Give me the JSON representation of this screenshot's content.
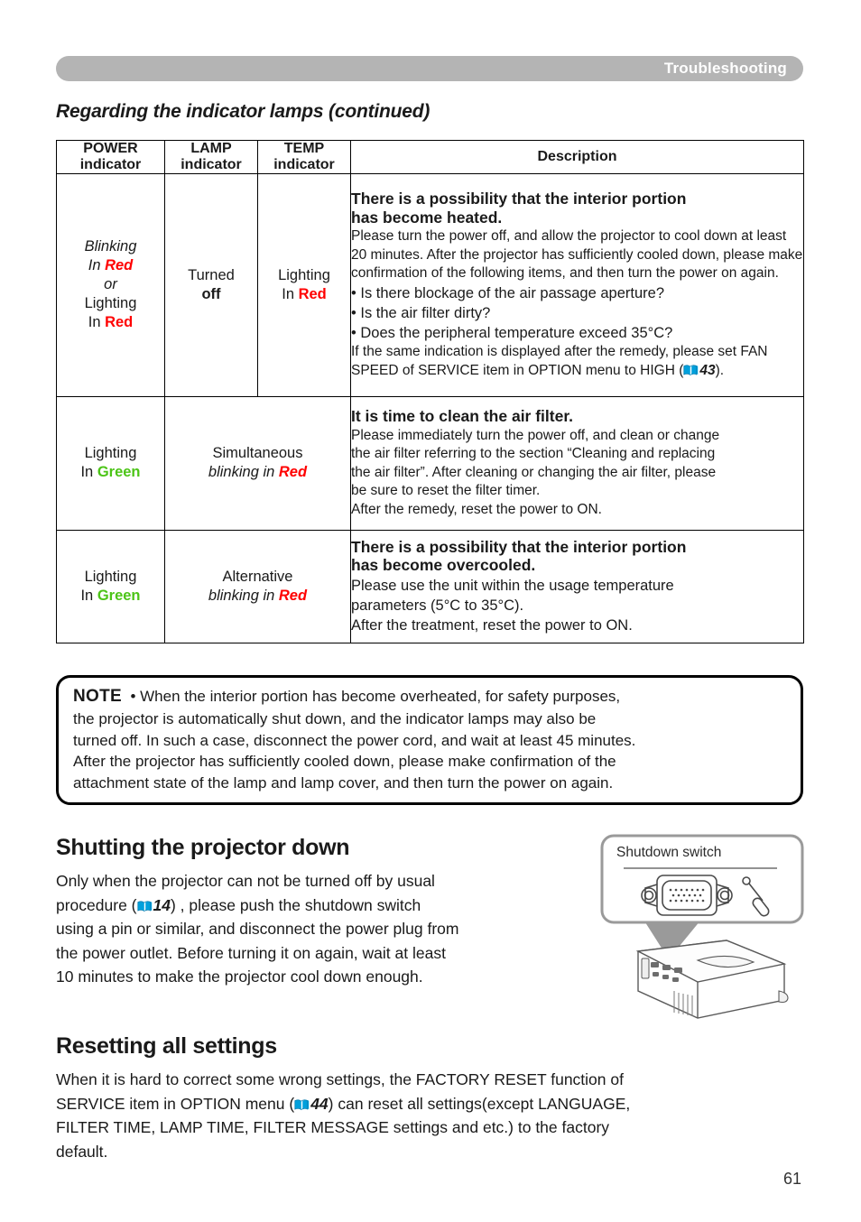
{
  "header": {
    "title": "Troubleshooting"
  },
  "section_heading": "Regarding the indicator lamps (continued)",
  "table": {
    "columns": [
      "POWER indicator",
      "LAMP indicator",
      "TEMP indicator",
      "Description"
    ],
    "column_labels": {
      "power_top": "POWER",
      "power_bottom": "indicator",
      "lamp_top": "LAMP",
      "lamp_bottom": "indicator",
      "temp_top": "TEMP",
      "temp_bottom": "indicator",
      "description": "Description"
    },
    "rows": [
      {
        "power": {
          "l1": "Blinking",
          "l2_prefix": "In ",
          "l2_color": "Red",
          "l3": "or",
          "l4": "Lighting",
          "l5_prefix": "In ",
          "l5_color": "Red"
        },
        "lamp": {
          "l1": "Turned",
          "l2": "off"
        },
        "temp": {
          "l1": "Lighting",
          "l2_prefix": "In ",
          "l2_color": "Red"
        },
        "title_lines": [
          "There is a possibility that the interior portion",
          "has become heated."
        ],
        "body_lines": [
          "Please turn the power off, and allow the projector to cool down at least",
          "20 minutes. After the projector has sufficiently cooled down, please make",
          "confirmation of the following items, and then turn the power on again."
        ],
        "bullets": [
          "• Is there blockage of the air passage aperture?",
          "• Is the air filter dirty?",
          "• Does the peripheral temperature exceed 35°C?"
        ],
        "tail_lines": [
          "If the same indication is displayed after the remedy, please set FAN",
          "SPEED of SERVICE item in OPTION menu to HIGH ("
        ],
        "tail_ref": "43",
        "tail_end": ")."
      },
      {
        "power": {
          "l1": "Lighting",
          "l2_prefix": "In ",
          "l2_color": "Green"
        },
        "lamp": {
          "l1": "Simultaneous",
          "l2_italic": "blinking in ",
          "l2_color": "Red"
        },
        "title_lines": [
          "It is time to clean the air filter."
        ],
        "body_lines": [
          "Please immediately turn the power off, and clean or change",
          "the air filter referring to the section “Cleaning and replacing",
          "the air filter”. After cleaning or changing the air filter, please",
          "be sure to reset the filter timer.",
          "After the remedy, reset the power to ON."
        ]
      },
      {
        "power": {
          "l1": "Lighting",
          "l2_prefix": "In ",
          "l2_color": "Green"
        },
        "lamp": {
          "l1": "Alternative",
          "l2_italic": "blinking in ",
          "l2_color": "Red"
        },
        "title_lines": [
          "There is a possibility that the interior portion",
          "has become overcooled."
        ],
        "body_lines": [
          "Please use the unit within the usage temperature",
          "parameters (5°C to 35°C).",
          "After the treatment, reset the power to ON."
        ]
      }
    ]
  },
  "note": {
    "label": "NOTE",
    "lines": [
      "• When the interior portion has become overheated, for safety purposes,",
      "the projector is automatically shut down, and the indicator lamps may also be",
      "turned off. In such a case, disconnect the power cord, and wait at least 45 minutes.",
      "After the projector has sufficiently cooled down, please make confirmation of the",
      "attachment state of the lamp and lamp cover, and then turn the power on again."
    ]
  },
  "shutting_section": {
    "heading": "Shutting the projector down",
    "line1": "Only when the projector can not be turned off by usual",
    "line2_pre": "procedure (",
    "line2_ref": "14",
    "line2_post": ") , please push the shutdown switch",
    "line3": "using a pin or similar, and disconnect the power plug from",
    "line4": "the power outlet. Before turning it on again, wait at least",
    "line5": "10 minutes to make the projector cool down enough."
  },
  "figure": {
    "callout_label": "Shutdown switch",
    "icon_names": [
      "vga-port-icon",
      "pin-tool-icon",
      "projector-illustration"
    ]
  },
  "reset_section": {
    "heading": "Resetting all settings",
    "line1": "When it is hard to correct some wrong settings, the FACTORY RESET function of",
    "line2_pre": "SERVICE item in OPTION menu (",
    "line2_ref": "44",
    "line2_post": ") can reset all settings(except LANGUAGE,",
    "line3": "FILTER TIME, LAMP TIME, FILTER MESSAGE settings and etc.) to the factory",
    "line4": "default."
  },
  "page_number": "61",
  "colors": {
    "red": "#ff0000",
    "green": "#4cc417",
    "header_bar": "#b4b4b4",
    "book_icon": "#00a0dc"
  }
}
